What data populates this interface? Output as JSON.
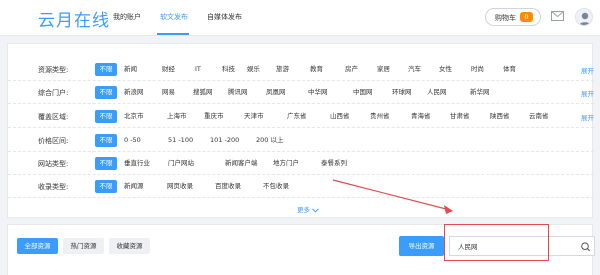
{
  "header": {
    "logo": "云月在线",
    "nav": [
      {
        "label": "我的账户",
        "active": false
      },
      {
        "label": "软文发布",
        "active": true
      },
      {
        "label": "自媒体发布",
        "active": false
      }
    ],
    "cart_label": "购物车",
    "cart_count": "0"
  },
  "filters": {
    "unlimited_label": "不限",
    "expand_label": "展开",
    "more_label": "更多",
    "rows": [
      {
        "label": "资源类型:",
        "options": [
          "新闻",
          "财经",
          "IT",
          "科技",
          "娱乐",
          "旅游",
          "教育",
          "房产",
          "家居",
          "汽车",
          "女性",
          "时尚",
          "体育"
        ],
        "expandable": true
      },
      {
        "label": "综合门户:",
        "options": [
          "新浪网",
          "网易",
          "搜狐网",
          "腾讯网",
          "凤凰网",
          "中华网",
          "中国网",
          "环球网",
          "人民网",
          "新华网"
        ],
        "expandable": true
      },
      {
        "label": "覆盖区域:",
        "options": [
          "北京市",
          "上海市",
          "重庆市",
          "天津市",
          "广东省",
          "山西省",
          "贵州省",
          "青海省",
          "甘肃省",
          "陕西省",
          "云南省"
        ],
        "expandable": true
      },
      {
        "label": "价格区间:",
        "options": [
          "0 -50",
          "51 -100",
          "101 -200",
          "200 以上"
        ],
        "expandable": false
      },
      {
        "label": "网站类型:",
        "options": [
          "垂直行业",
          "门户网站",
          "新闻客户端",
          "地方门户",
          "泰餐系列"
        ],
        "expandable": false
      },
      {
        "label": "收录类型:",
        "options": [
          "新闻源",
          "网页收录",
          "百度收录",
          "不包收录"
        ],
        "expandable": false
      }
    ]
  },
  "toolbar": {
    "tabs": [
      {
        "label": "全部资源",
        "active": true
      },
      {
        "label": "热门资源",
        "active": false
      },
      {
        "label": "收藏资源",
        "active": false
      }
    ],
    "export_label": "导出资源",
    "search_value": "人民网"
  },
  "colors": {
    "accent": "#3a9dfb",
    "badge": "#ff8a00",
    "annotation": "#e5484d"
  }
}
